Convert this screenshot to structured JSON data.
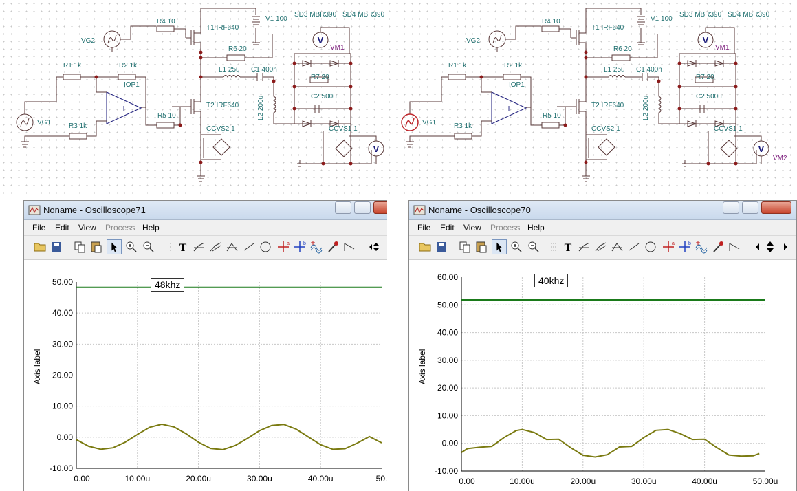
{
  "schematics": [
    {
      "labels": {
        "r4": "R4 10",
        "t1": "T1 IRF640",
        "v1": "V1 100",
        "sd3": "SD3 MBR390",
        "sd4": "SD4 MBR390",
        "vg2": "VG2",
        "vm1": "VM1",
        "r6": "R6 20",
        "r1": "R1 1k",
        "r2": "R2 1k",
        "iop1": "IOP1",
        "l1": "L1 25u",
        "c1": "C1 400n",
        "r7": "R7 20",
        "c2": "C2 500u",
        "l2": "L2 200u",
        "r5": "R5 10",
        "t2": "T2 IRF640",
        "vg1": "VG1",
        "r3": "R3 1k",
        "ccvs2": "CCVS2 1",
        "ccvs1": "CCVS1 1",
        "vm2": "",
        "vmeter": "V",
        "opamp_sign": "I"
      }
    },
    {
      "labels": {
        "r4": "R4 10",
        "t1": "T1 IRF640",
        "v1": "V1 100",
        "sd3": "SD3 MBR390",
        "sd4": "SD4 MBR390",
        "vg2": "VG2",
        "vm1": "VM1",
        "r6": "R6 20",
        "r1": "R1 1k",
        "r2": "R2 1k",
        "iop1": "IOP1",
        "l1": "L1 25u",
        "c1": "C1 400n",
        "r7": "R7 20",
        "c2": "C2 500u",
        "l2": "L2 200u",
        "r5": "R5 10",
        "t2": "T2 IRF640",
        "vg1": "VG1",
        "r3": "R3 1k",
        "ccvs2": "CCVS2 1",
        "ccvs1": "CCVS1 1",
        "vm2": "VM2",
        "vmeter": "V",
        "opamp_sign": "I"
      }
    }
  ],
  "windows": [
    {
      "title": "Noname - Oscilloscope71",
      "menu": [
        "File",
        "Edit",
        "View",
        "Process",
        "Help"
      ],
      "annotation": "48khz"
    },
    {
      "title": "Noname - Oscilloscope70",
      "menu": [
        "File",
        "Edit",
        "View",
        "Process",
        "Help"
      ],
      "annotation": "40khz"
    }
  ],
  "chart_data": [
    {
      "type": "line",
      "title": "",
      "xlabel": "",
      "ylabel": "Axis label",
      "xlim": [
        0,
        50
      ],
      "ylim": [
        -10,
        50
      ],
      "xticks": [
        "0.00",
        "10.00u",
        "20.00u",
        "30.00u",
        "40.00u",
        "50."
      ],
      "yticks": [
        "50.00",
        "40.00",
        "30.00",
        "20.00",
        "10.00",
        "0.00",
        "-10.00"
      ],
      "grid": true,
      "colors": {
        "dc": "#1a7a1a",
        "ac": "#7a7a10"
      },
      "series": [
        {
          "x": [
            0,
            50
          ],
          "y": [
            48.3,
            48.3
          ]
        },
        {
          "x": [
            0,
            2,
            4,
            6,
            8,
            10,
            12,
            14,
            16,
            18,
            20,
            22,
            24,
            26,
            28,
            30,
            32,
            34,
            36,
            38,
            40,
            42,
            44,
            46,
            48,
            50
          ],
          "y": [
            -0.8,
            -2.9,
            -3.9,
            -3.4,
            -1.6,
            0.9,
            3.2,
            4.2,
            3.3,
            1.1,
            -1.6,
            -3.6,
            -4.0,
            -2.7,
            -0.4,
            2.1,
            3.8,
            4.1,
            2.6,
            0.1,
            -2.4,
            -3.9,
            -3.7,
            -1.9,
            0.2,
            -1.8
          ]
        }
      ]
    },
    {
      "type": "line",
      "title": "",
      "xlabel": "",
      "ylabel": "Axis label",
      "xlim": [
        0,
        50
      ],
      "ylim": [
        -10,
        60
      ],
      "xticks": [
        "0.00",
        "10.00u",
        "20.00u",
        "30.00u",
        "40.00u",
        "50.00u"
      ],
      "yticks": [
        "60.00",
        "50.00",
        "40.00",
        "30.00",
        "20.00",
        "10.00",
        "0.00",
        "-10.00"
      ],
      "grid": true,
      "colors": {
        "dc": "#1a7a1a",
        "ac": "#7a7a10"
      },
      "series": [
        {
          "x": [
            0,
            50
          ],
          "y": [
            51.8,
            51.8
          ]
        },
        {
          "x": [
            0,
            1,
            3,
            5,
            7,
            9,
            10,
            12,
            14,
            16,
            18,
            20,
            22,
            24,
            26,
            28,
            30,
            32,
            34,
            36,
            38,
            40,
            42,
            44,
            46,
            48,
            49
          ],
          "y": [
            -3.3,
            -1.9,
            -1.4,
            -1.1,
            2.1,
            4.6,
            5.0,
            3.9,
            1.4,
            1.5,
            -1.6,
            -4.3,
            -4.9,
            -4.1,
            -1.3,
            -1.1,
            2.1,
            4.7,
            5.0,
            3.5,
            1.4,
            1.5,
            -1.5,
            -4.2,
            -4.6,
            -4.5,
            -3.7
          ]
        }
      ]
    }
  ]
}
